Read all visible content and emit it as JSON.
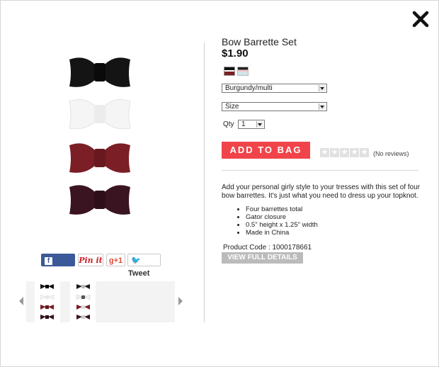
{
  "product": {
    "title": "Bow Barrette Set",
    "price": "$1.90",
    "color_select": "Burgundy/multi",
    "size_select": "Size",
    "qty_label": "Qty",
    "qty_value": "1",
    "add_to_bag": "ADD TO BAG",
    "rating": 0,
    "reviews": "(No reviews)",
    "description": "Add your personal girly style to your tresses with this set of four bow barrettes. It's just what you need to dress up your topknot.",
    "features": [
      "Four barrettes total",
      "Gator closure",
      "0.5\" height x 1.25\" width",
      "Made in China"
    ],
    "product_code": "Product Code : 1000178661",
    "view_details": "VIEW FULL DETAILS"
  },
  "social": {
    "share": "Share",
    "pin": "Pin it",
    "gplus": "g+1",
    "tweet": "Tweet"
  },
  "colors": {
    "accent": "#f0444a",
    "bow_black": "#141414",
    "bow_white": "#f5f5f5",
    "bow_burgundy": "#7b1e26",
    "bow_plum": "#3a1420"
  },
  "icons": [
    "close-icon",
    "facebook-icon",
    "twitter-icon",
    "star-icon",
    "chevron-left-icon",
    "chevron-right-icon"
  ]
}
